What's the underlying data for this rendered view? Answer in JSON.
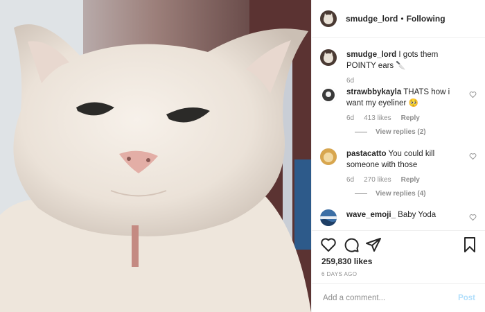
{
  "post": {
    "image_subject": "photo",
    "author": {
      "username": "smudge_lord",
      "separator": "•",
      "follow_status": "Following",
      "avatar_icon": "cat-avatar-icon"
    }
  },
  "caption": {
    "username": "smudge_lord",
    "text": "I gots them POINTY ears 🔪",
    "age": "6d"
  },
  "comments": [
    {
      "username": "strawbbykayla",
      "text": "THATS how i want my eyeliner 🥺",
      "age": "6d",
      "likes": "413 likes",
      "reply_label": "Reply",
      "view_replies": "View replies (2)"
    },
    {
      "username": "pastacatto",
      "text": "You could kill someone with those",
      "age": "6d",
      "likes": "270 likes",
      "reply_label": "Reply",
      "view_replies": "View replies (4)"
    },
    {
      "username": "wave_emoji_",
      "text": "Baby Yoda"
    }
  ],
  "actions": {
    "icons": [
      "heart-icon",
      "comment-icon",
      "share-icon",
      "bookmark-icon"
    ],
    "likes_count": "259,830 likes",
    "posted_date": "6 DAYS AGO"
  },
  "add_comment": {
    "placeholder": "Add a comment...",
    "post_label": "Post",
    "post_color": "#b2dffc"
  }
}
